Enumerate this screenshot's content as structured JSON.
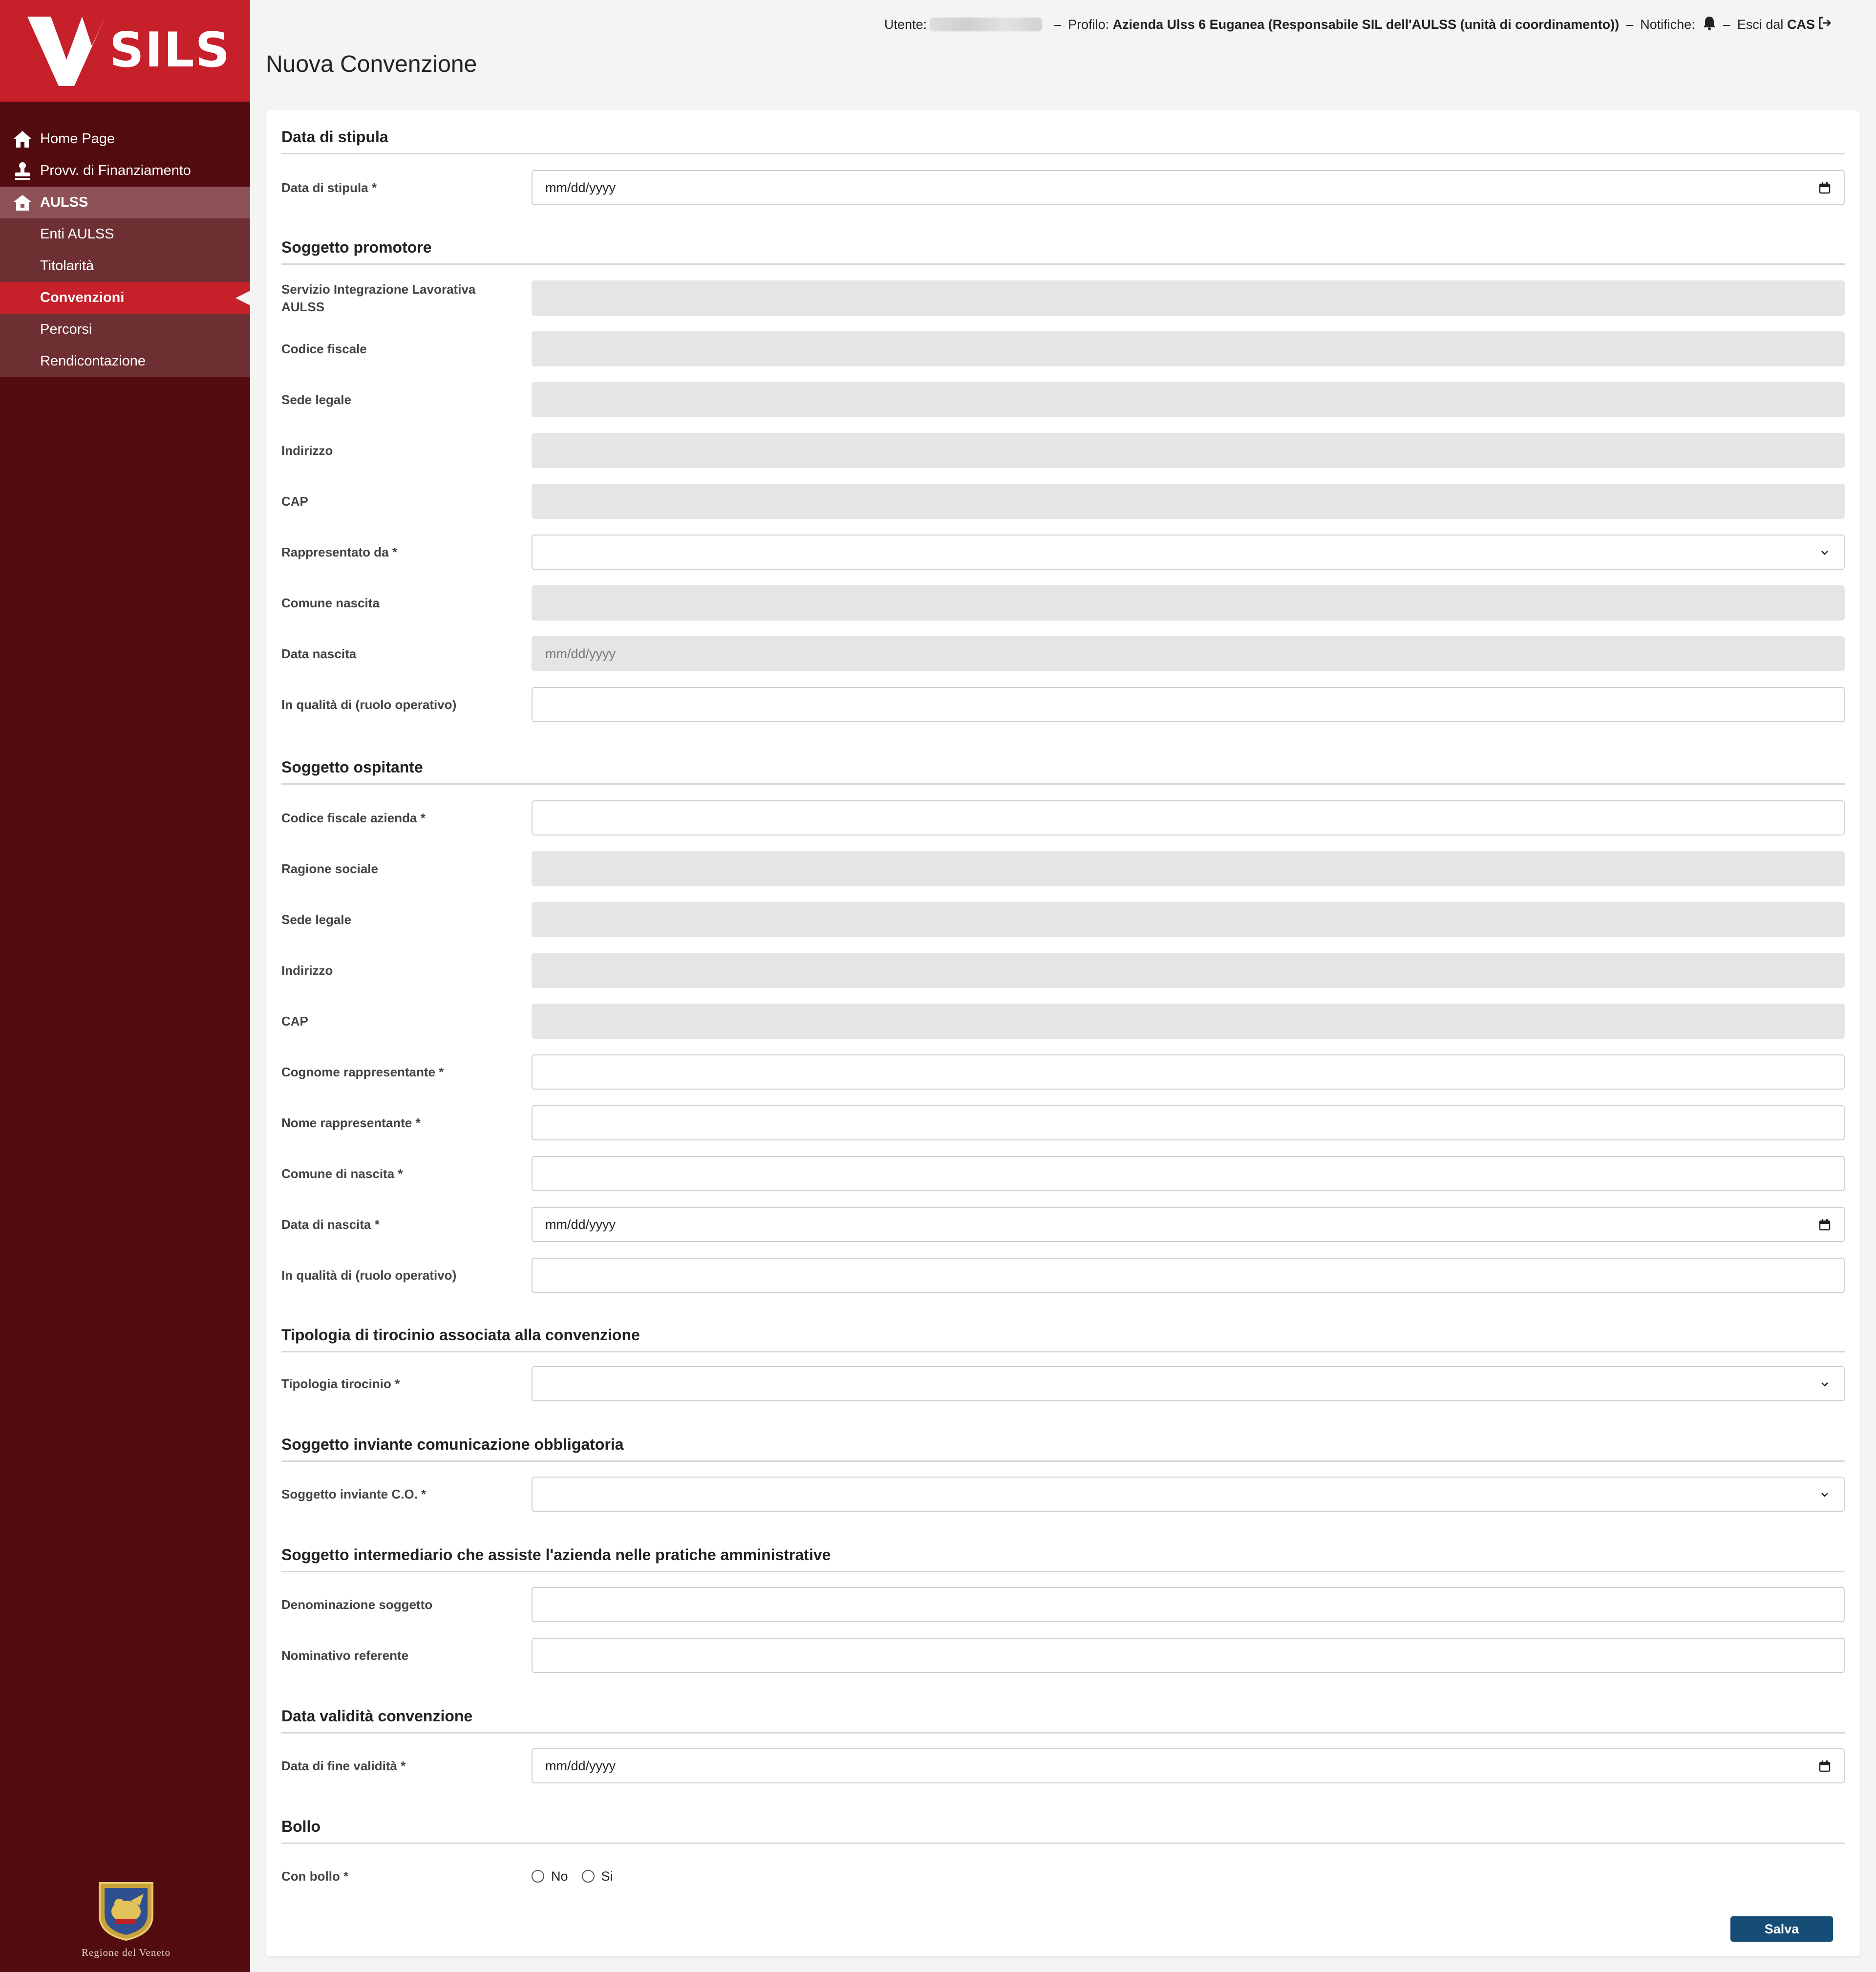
{
  "app": {
    "name": "SILS",
    "region_label": "Regione del Veneto"
  },
  "header": {
    "user_label": "Utente:",
    "profile_label": "Profilo:",
    "profile_value": "Azienda Ulss 6 Euganea (Responsabile SIL dell'AULSS (unità di coordinamento))",
    "notifications_label": "Notifiche:",
    "logout_prefix": "Esci dal",
    "logout_target": "CAS",
    "separator": "–"
  },
  "page_title": "Nuova Convenzione",
  "sidebar": {
    "items": [
      {
        "label": "Home Page",
        "icon": "home-icon"
      },
      {
        "label": "Provv. di Finanziamento",
        "icon": "stamp-icon"
      },
      {
        "label": "AULSS",
        "icon": "building-icon"
      },
      {
        "label": "Enti AULSS"
      },
      {
        "label": "Titolarità"
      },
      {
        "label": "Convenzioni"
      },
      {
        "label": "Percorsi"
      },
      {
        "label": "Rendicontazione"
      }
    ]
  },
  "form": {
    "sections": {
      "stipula": "Data di stipula",
      "promotore": "Soggetto promotore",
      "ospitante": "Soggetto ospitante",
      "tipologia": "Tipologia di tirocinio associata alla convenzione",
      "inviante": "Soggetto inviante comunicazione obbligatoria",
      "intermediario": "Soggetto intermediario che assiste l'azienda nelle pratiche amministrative",
      "validita": "Data validità convenzione",
      "bollo": "Bollo"
    },
    "fields": {
      "data_stipula": {
        "label": "Data di stipula *",
        "placeholder": "mm/dd/yyyy"
      },
      "sil_aulss": {
        "label": "Servizio Integrazione Lavorativa AULSS",
        "value": ""
      },
      "prom_cf": {
        "label": "Codice fiscale",
        "value": ""
      },
      "prom_sede": {
        "label": "Sede legale",
        "value": ""
      },
      "prom_indirizzo": {
        "label": "Indirizzo",
        "value": ""
      },
      "prom_cap": {
        "label": "CAP",
        "value": ""
      },
      "rappresentato_da": {
        "label": "Rappresentato da *",
        "value": ""
      },
      "comune_nascita": {
        "label": "Comune nascita",
        "value": ""
      },
      "data_nascita": {
        "label": "Data nascita",
        "placeholder": "mm/dd/yyyy"
      },
      "prom_qualita": {
        "label": "In qualità di (ruolo operativo)",
        "value": ""
      },
      "osp_cf": {
        "label": "Codice fiscale azienda *",
        "value": ""
      },
      "osp_ragione": {
        "label": "Ragione sociale",
        "value": ""
      },
      "osp_sede": {
        "label": "Sede legale",
        "value": ""
      },
      "osp_indirizzo": {
        "label": "Indirizzo",
        "value": ""
      },
      "osp_cap": {
        "label": "CAP",
        "value": ""
      },
      "osp_cognome": {
        "label": "Cognome rappresentante *",
        "value": ""
      },
      "osp_nome": {
        "label": "Nome rappresentante *",
        "value": ""
      },
      "osp_comune": {
        "label": "Comune di nascita *",
        "value": ""
      },
      "osp_data_nascita": {
        "label": "Data di nascita *",
        "placeholder": "mm/dd/yyyy"
      },
      "osp_qualita": {
        "label": "In qualità di (ruolo operativo)",
        "value": ""
      },
      "tipologia": {
        "label": "Tipologia tirocinio *",
        "value": ""
      },
      "inviante": {
        "label": "Soggetto inviante C.O. *",
        "value": ""
      },
      "denominazione": {
        "label": "Denominazione soggetto",
        "value": ""
      },
      "referente": {
        "label": "Nominativo referente",
        "value": ""
      },
      "fine_validita": {
        "label": "Data di fine validità *",
        "placeholder": "mm/dd/yyyy"
      },
      "bollo": {
        "label": "Con bollo *",
        "options": [
          "No",
          "Si"
        ]
      }
    },
    "save_label": "Salva"
  },
  "colors": {
    "brand_red": "#c6202b",
    "sidebar_dark": "#520c10",
    "save_blue": "#154d76"
  }
}
